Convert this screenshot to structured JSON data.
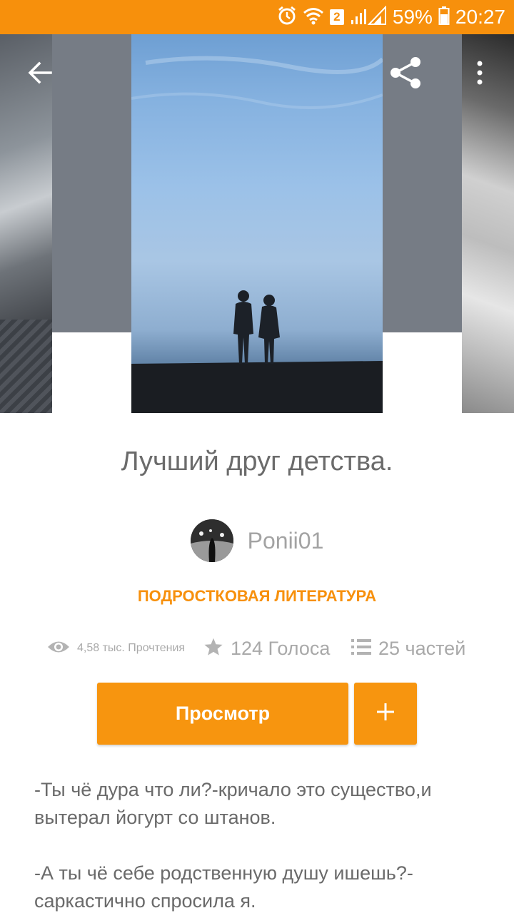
{
  "status_bar": {
    "battery_percent": "59%",
    "time": "20:27",
    "wifi_badge": "2",
    "icons": [
      "alarm-icon",
      "wifi-icon",
      "signal-icon",
      "battery-icon"
    ],
    "background_color": "#f7900c"
  },
  "header": {
    "icons": [
      "back-arrow-icon",
      "share-icon",
      "more-vert-icon"
    ]
  },
  "story": {
    "title": "Лучший друг детства.",
    "author": "Ponii01",
    "category": "ПОДРОСТКОВАЯ ЛИТЕРАТУРА",
    "reads": "4,58 тыс. Прочтения",
    "votes": "124 Голоса",
    "parts": "25 частей"
  },
  "actions": {
    "read_label": "Просмотр",
    "add_icon": "plus-icon",
    "accent_color": "#f7950f"
  },
  "excerpt": {
    "paragraphs": [
      "-Ты чё дура что ли?-кричало это существо,и вытерал йогурт со штанов.",
      "-А ты чё себе родственную душу ишешь?-саркастично спросила я."
    ]
  }
}
